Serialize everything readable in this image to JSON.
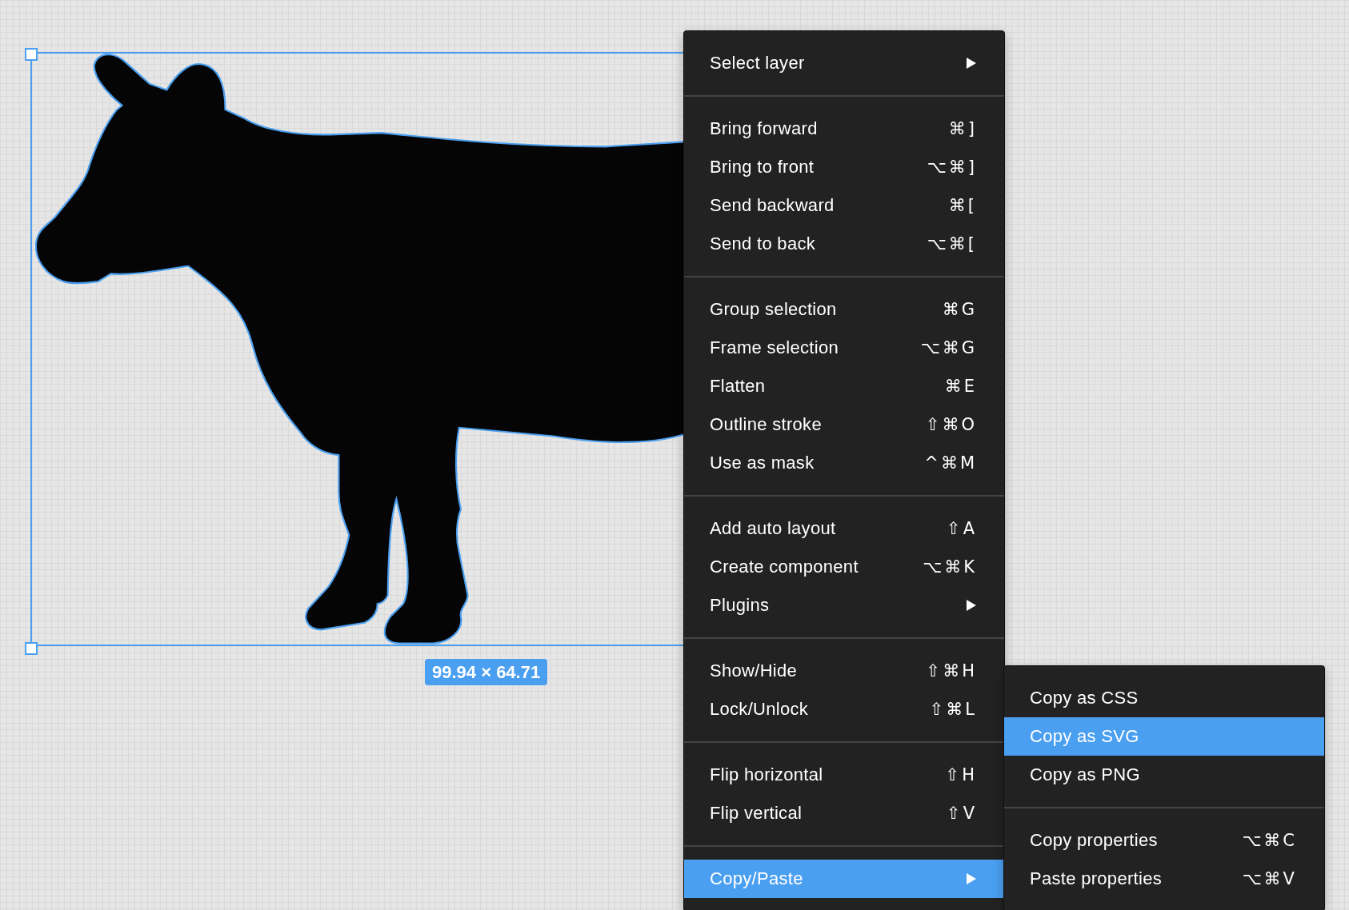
{
  "canvas": {
    "selection": {
      "size_label": "99.94 × 64.71"
    }
  },
  "context_menu": {
    "sections": [
      [
        {
          "label": "Select layer",
          "kind": "submenu",
          "selected": false
        }
      ],
      [
        {
          "label": "Bring forward",
          "shortcut": "⌘]",
          "kind": "command",
          "selected": false
        },
        {
          "label": "Bring to front",
          "shortcut": "⌥⌘]",
          "kind": "command",
          "selected": false
        },
        {
          "label": "Send backward",
          "shortcut": "⌘[",
          "kind": "command",
          "selected": false
        },
        {
          "label": "Send to back",
          "shortcut": "⌥⌘[",
          "kind": "command",
          "selected": false
        }
      ],
      [
        {
          "label": "Group selection",
          "shortcut": "⌘G",
          "kind": "command",
          "selected": false
        },
        {
          "label": "Frame selection",
          "shortcut": "⌥⌘G",
          "kind": "command",
          "selected": false
        },
        {
          "label": "Flatten",
          "shortcut": "⌘E",
          "kind": "command",
          "selected": false
        },
        {
          "label": "Outline stroke",
          "shortcut": "⇧⌘O",
          "kind": "command",
          "selected": false
        },
        {
          "label": "Use as mask",
          "shortcut": "^⌘M",
          "kind": "command",
          "selected": false
        }
      ],
      [
        {
          "label": "Add auto layout",
          "shortcut": "⇧A",
          "kind": "command",
          "selected": false
        },
        {
          "label": "Create component",
          "shortcut": "⌥⌘K",
          "kind": "command",
          "selected": false
        },
        {
          "label": "Plugins",
          "kind": "submenu",
          "selected": false
        }
      ],
      [
        {
          "label": "Show/Hide",
          "shortcut": "⇧⌘H",
          "kind": "command",
          "selected": false
        },
        {
          "label": "Lock/Unlock",
          "shortcut": "⇧⌘L",
          "kind": "command",
          "selected": false
        }
      ],
      [
        {
          "label": "Flip horizontal",
          "shortcut": "⇧H",
          "kind": "command",
          "selected": false
        },
        {
          "label": "Flip vertical",
          "shortcut": "⇧V",
          "kind": "command",
          "selected": false
        }
      ],
      [
        {
          "label": "Copy/Paste",
          "kind": "submenu",
          "selected": true
        }
      ]
    ]
  },
  "submenu": {
    "sections": [
      [
        {
          "label": "Copy as CSS",
          "kind": "command",
          "selected": false
        },
        {
          "label": "Copy as SVG",
          "kind": "command",
          "selected": true
        },
        {
          "label": "Copy as PNG",
          "kind": "command",
          "selected": false
        }
      ],
      [
        {
          "label": "Copy properties",
          "shortcut": "⌥⌘C",
          "kind": "command",
          "selected": false
        },
        {
          "label": "Paste properties",
          "shortcut": "⌥⌘V",
          "kind": "command",
          "selected": false
        }
      ]
    ]
  }
}
